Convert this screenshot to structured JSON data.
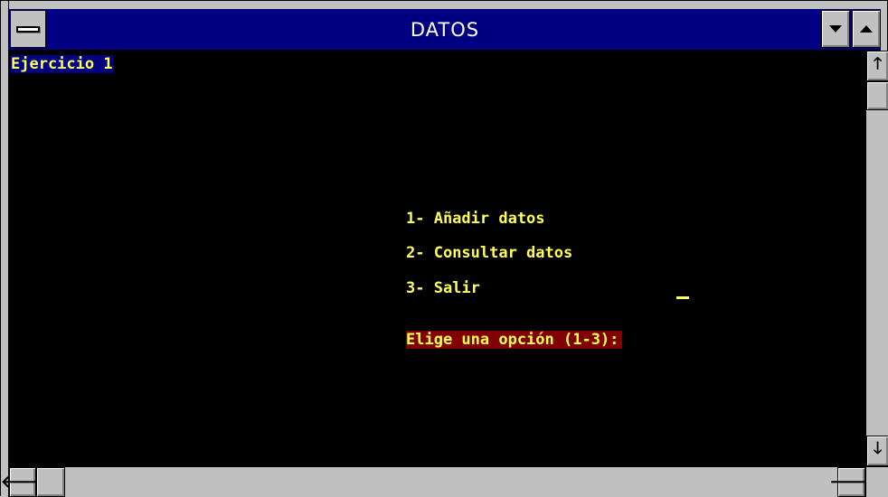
{
  "window": {
    "title": "DATOS"
  },
  "console": {
    "heading": "Ejercicio 1",
    "options": [
      "1- Añadir datos",
      "2- Consultar datos",
      "3- Salir"
    ],
    "prompt": "Elige una opción (1-3):"
  },
  "icons": {
    "system_menu": "system-menu-icon",
    "minimize": "minimize-arrow-icon",
    "maximize": "maximize-arrow-icon",
    "scroll_up": "arrow-up-icon",
    "scroll_down": "arrow-down-icon",
    "scroll_left": "arrow-left-icon",
    "scroll_right": "arrow-right-icon"
  },
  "glyphs": {
    "up": "🡑",
    "down": "🡓",
    "left": "🡐",
    "right": "🡒"
  },
  "colors": {
    "titlebar": "#000080",
    "console_bg": "#000000",
    "text": "#ffff55",
    "heading_bg": "#000080",
    "prompt_bg": "#800000",
    "chrome": "#c0c0c0"
  }
}
